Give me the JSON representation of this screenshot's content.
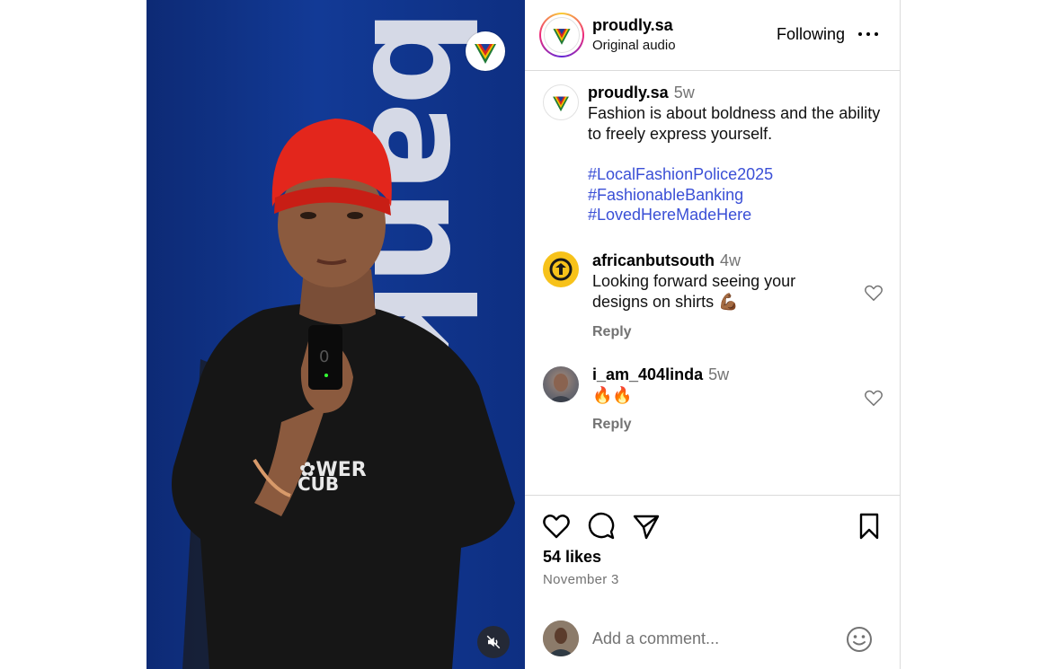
{
  "media": {
    "background_word": "bank",
    "shirt_text": "POWER CLUB",
    "mute_icon": "speaker-muted-icon",
    "badge_icon": "proudly-sa-logo"
  },
  "header": {
    "username": "proudly.sa",
    "audio": "Original audio",
    "following_label": "Following",
    "more_icon": "more-horizontal-icon"
  },
  "caption": {
    "username": "proudly.sa",
    "age": "5w",
    "text": "Fashion is about boldness and the ability to freely express yourself.",
    "hashtags": [
      "#LocalFashionPolice2025",
      "#FashionableBanking",
      "#LovedHereMadeHere"
    ]
  },
  "comments": [
    {
      "username": "africanbutsouth",
      "age": "4w",
      "text": "Looking forward seeing your designs on shirts 💪🏾",
      "reply_label": "Reply"
    },
    {
      "username": "i_am_404linda",
      "age": "5w",
      "text": "🔥🔥",
      "reply_label": "Reply"
    }
  ],
  "actions": {
    "likes": "54 likes",
    "date": "November 3",
    "icons": [
      "heart-icon",
      "comment-icon",
      "share-icon",
      "bookmark-icon"
    ]
  },
  "add_comment": {
    "placeholder": "Add a comment...",
    "emoji_icon": "smiley-icon"
  },
  "colors": {
    "hashtag": "#3a4fd6",
    "secondary_text": "#737373",
    "divider": "#dbdbdb",
    "media_blue": "#123a96"
  }
}
